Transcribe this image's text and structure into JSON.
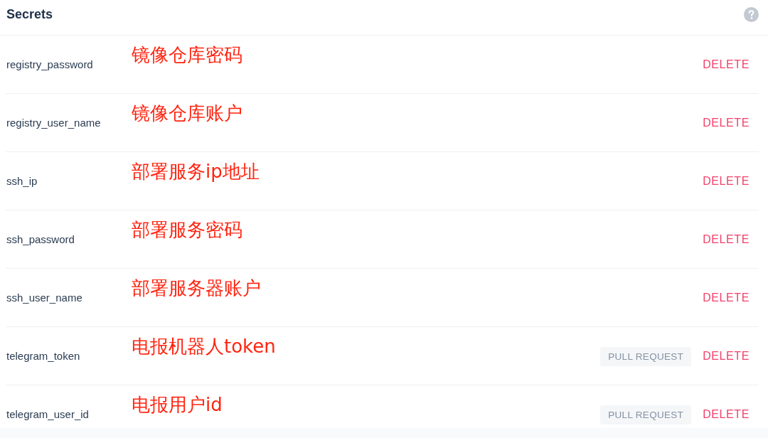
{
  "header": {
    "title": "Secrets"
  },
  "secrets": [
    {
      "name": "registry_password",
      "annotation": "镜像仓库密码",
      "action": "DELETE"
    },
    {
      "name": "registry_user_name",
      "annotation": "镜像仓库账户",
      "action": "DELETE"
    },
    {
      "name": "ssh_ip",
      "annotation": "部署服务ip地址",
      "action": "DELETE"
    },
    {
      "name": "ssh_password",
      "annotation": "部署服务密码",
      "action": "DELETE"
    },
    {
      "name": "ssh_user_name",
      "annotation": "部署服务器账户",
      "action": "DELETE"
    },
    {
      "name": "telegram_token",
      "annotation": "电报机器人token",
      "badge": "PULL REQUEST",
      "action": "DELETE"
    },
    {
      "name": "telegram_user_id",
      "annotation": "电报用户id",
      "badge": "PULL REQUEST",
      "action": "DELETE"
    }
  ]
}
